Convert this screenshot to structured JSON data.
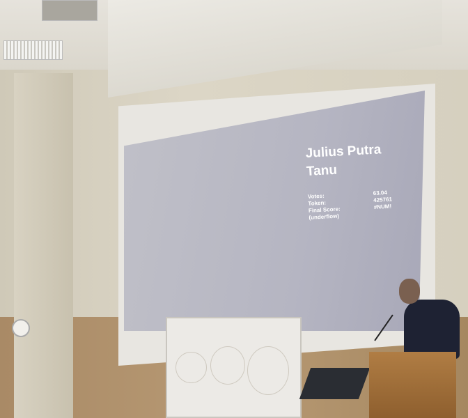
{
  "slide": {
    "name_line1": "Julius Putra",
    "name_line2": "Tanu",
    "stats": [
      {
        "label": "Votes:",
        "value": "63.04"
      },
      {
        "label": "Token:",
        "value": "425761"
      },
      {
        "label": "Final Score:",
        "value": "#NUM!"
      },
      {
        "label": "(underflow)",
        "value": ""
      }
    ]
  }
}
